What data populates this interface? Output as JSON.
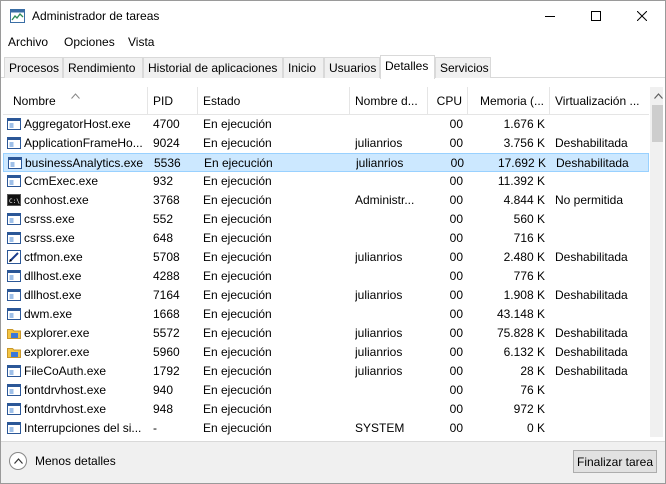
{
  "window": {
    "title": "Administrador de tareas"
  },
  "menu": [
    "Archivo",
    "Opciones",
    "Vista"
  ],
  "tabs": [
    "Procesos",
    "Rendimiento",
    "Historial de aplicaciones",
    "Inicio",
    "Usuarios",
    "Detalles",
    "Servicios"
  ],
  "active_tab": "Detalles",
  "columns": [
    "Nombre",
    "PID",
    "Estado",
    "Nombre d...",
    "CPU",
    "Memoria (...",
    "Virtualización ..."
  ],
  "sort_indicator": "^",
  "rows": [
    {
      "name": "AggregatorHost.exe",
      "pid": "4700",
      "status": "En ejecución",
      "user": "",
      "cpu": "00",
      "mem": "1.676 K",
      "virt": "",
      "icon": "window-icon"
    },
    {
      "name": "ApplicationFrameHo...",
      "pid": "9024",
      "status": "En ejecución",
      "user": "julianrios",
      "cpu": "00",
      "mem": "3.756 K",
      "virt": "Deshabilitada",
      "icon": "window-icon"
    },
    {
      "name": "businessAnalytics.exe",
      "pid": "5536",
      "status": "En ejecución",
      "user": "julianrios",
      "cpu": "00",
      "mem": "17.692 K",
      "virt": "Deshabilitada",
      "icon": "window-icon"
    },
    {
      "name": "CcmExec.exe",
      "pid": "932",
      "status": "En ejecución",
      "user": "",
      "cpu": "00",
      "mem": "11.392 K",
      "virt": "",
      "icon": "window-icon"
    },
    {
      "name": "conhost.exe",
      "pid": "3768",
      "status": "En ejecución",
      "user": "Administr...",
      "cpu": "00",
      "mem": "4.844 K",
      "virt": "No permitida",
      "icon": "console-icon"
    },
    {
      "name": "csrss.exe",
      "pid": "552",
      "status": "En ejecución",
      "user": "",
      "cpu": "00",
      "mem": "560 K",
      "virt": "",
      "icon": "window-icon"
    },
    {
      "name": "csrss.exe",
      "pid": "648",
      "status": "En ejecución",
      "user": "",
      "cpu": "00",
      "mem": "716 K",
      "virt": "",
      "icon": "window-icon"
    },
    {
      "name": "ctfmon.exe",
      "pid": "5708",
      "status": "En ejecución",
      "user": "julianrios",
      "cpu": "00",
      "mem": "2.480 K",
      "virt": "Deshabilitada",
      "icon": "pen-icon"
    },
    {
      "name": "dllhost.exe",
      "pid": "4288",
      "status": "En ejecución",
      "user": "",
      "cpu": "00",
      "mem": "776 K",
      "virt": "",
      "icon": "window-icon"
    },
    {
      "name": "dllhost.exe",
      "pid": "7164",
      "status": "En ejecución",
      "user": "julianrios",
      "cpu": "00",
      "mem": "1.908 K",
      "virt": "Deshabilitada",
      "icon": "window-icon"
    },
    {
      "name": "dwm.exe",
      "pid": "1668",
      "status": "En ejecución",
      "user": "",
      "cpu": "00",
      "mem": "43.148 K",
      "virt": "",
      "icon": "window-icon"
    },
    {
      "name": "explorer.exe",
      "pid": "5572",
      "status": "En ejecución",
      "user": "julianrios",
      "cpu": "00",
      "mem": "75.828 K",
      "virt": "Deshabilitada",
      "icon": "folder-icon"
    },
    {
      "name": "explorer.exe",
      "pid": "5960",
      "status": "En ejecución",
      "user": "julianrios",
      "cpu": "00",
      "mem": "6.132 K",
      "virt": "Deshabilitada",
      "icon": "folder-icon"
    },
    {
      "name": "FileCoAuth.exe",
      "pid": "1792",
      "status": "En ejecución",
      "user": "julianrios",
      "cpu": "00",
      "mem": "28 K",
      "virt": "Deshabilitada",
      "icon": "window-icon"
    },
    {
      "name": "fontdrvhost.exe",
      "pid": "940",
      "status": "En ejecución",
      "user": "",
      "cpu": "00",
      "mem": "76 K",
      "virt": "",
      "icon": "window-icon"
    },
    {
      "name": "fontdrvhost.exe",
      "pid": "948",
      "status": "En ejecución",
      "user": "",
      "cpu": "00",
      "mem": "972 K",
      "virt": "",
      "icon": "window-icon"
    },
    {
      "name": "Interrupciones del si...",
      "pid": "-",
      "status": "En ejecución",
      "user": "SYSTEM",
      "cpu": "00",
      "mem": "0 K",
      "virt": "",
      "icon": "window-icon"
    }
  ],
  "selected_row": 2,
  "footer": {
    "less_details": "Menos detalles",
    "end_task": "Finalizar tarea"
  },
  "colors": {
    "selection_bg": "#cce8ff",
    "selection_border": "#99d1ff",
    "footer_bg": "#f0f0f0"
  }
}
